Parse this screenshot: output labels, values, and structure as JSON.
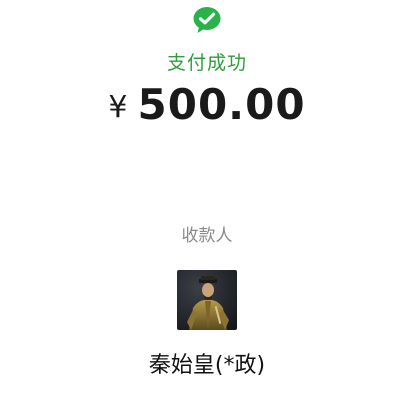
{
  "payment": {
    "status": "支付成功",
    "currency_symbol": "¥",
    "amount": "500.00",
    "payee_label": "收款人",
    "payee_name": "秦始皇(*政)"
  },
  "icons": {
    "status_icon": "wechat-pay-success-icon",
    "avatar": "payee-avatar-image"
  },
  "colors": {
    "brand_green": "#2f9e3a",
    "icon_green": "#27b34a",
    "text_primary": "#1a1a1a",
    "text_secondary": "#8a8a8a"
  }
}
